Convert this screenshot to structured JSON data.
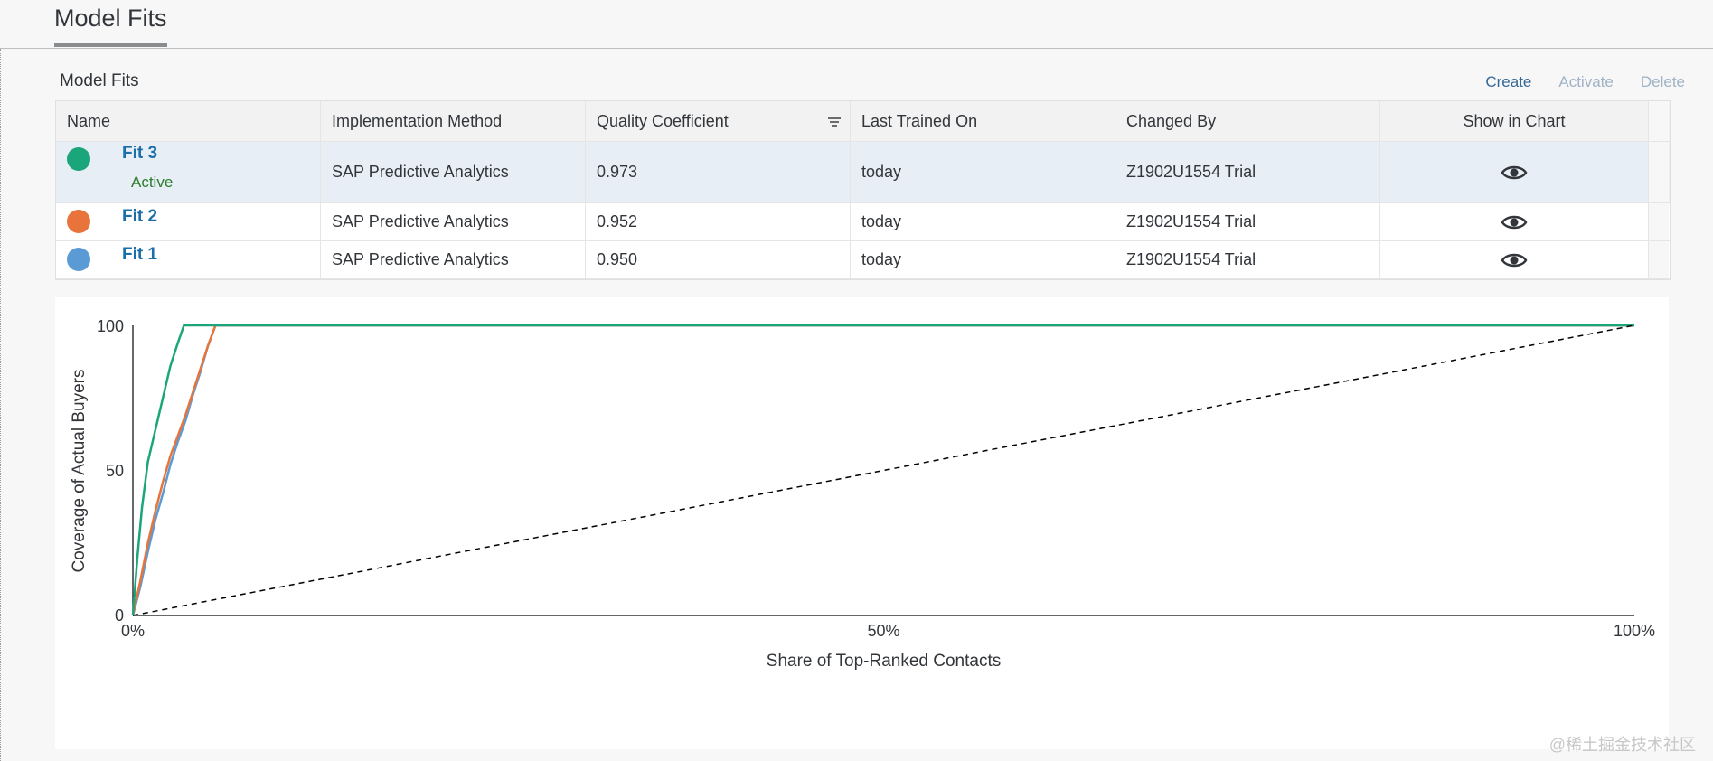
{
  "page": {
    "tab_title": "Model Fits"
  },
  "panel": {
    "title": "Model Fits",
    "actions": {
      "create": "Create",
      "activate": "Activate",
      "delete": "Delete"
    }
  },
  "table": {
    "headers": [
      "Name",
      "Implementation Method",
      "Quality Coefficient",
      "Last Trained On",
      "Changed By",
      "Show in Chart"
    ],
    "rows": [
      {
        "name": "Fit 3",
        "status": "Active",
        "method": "SAP Predictive Analytics",
        "quality": "0.973",
        "trained": "today",
        "changed_by": "Z1902U1554 Trial",
        "color": "#1aa67a"
      },
      {
        "name": "Fit 2",
        "status": "",
        "method": "SAP Predictive Analytics",
        "quality": "0.952",
        "trained": "today",
        "changed_by": "Z1902U1554 Trial",
        "color": "#e8743b"
      },
      {
        "name": "Fit 1",
        "status": "",
        "method": "SAP Predictive Analytics",
        "quality": "0.950",
        "trained": "today",
        "changed_by": "Z1902U1554 Trial",
        "color": "#5b9bd5"
      }
    ]
  },
  "chart_data": {
    "type": "line",
    "xlabel": "Share of Top-Ranked Contacts",
    "ylabel": "Coverage of Actual Buyers",
    "xlim": [
      0,
      100
    ],
    "ylim": [
      0,
      100
    ],
    "x_ticks": [
      "0%",
      "50%",
      "100%"
    ],
    "y_ticks": [
      "0",
      "50",
      "100"
    ],
    "grid": false,
    "series": [
      {
        "color": "#5b9bd5",
        "x": [
          0,
          0.5,
          1,
          1.5,
          2,
          2.5,
          3,
          3.5,
          4,
          4.5,
          5,
          5.5,
          100
        ],
        "y": [
          0,
          10,
          22,
          33,
          42,
          52,
          60,
          67,
          76,
          84,
          93,
          100,
          100
        ]
      },
      {
        "color": "#e8743b",
        "x": [
          0,
          0.5,
          1,
          1.5,
          2,
          2.5,
          3,
          3.5,
          4,
          4.5,
          5,
          5.5,
          100
        ],
        "y": [
          0,
          12,
          25,
          36,
          46,
          55,
          62,
          69,
          77,
          85,
          93,
          100,
          100
        ]
      },
      {
        "color": "#1aa67a",
        "x": [
          0,
          0.3,
          0.6,
          1,
          1.5,
          2,
          2.5,
          3,
          3.4,
          100
        ],
        "y": [
          0,
          20,
          37,
          53,
          64,
          75,
          86,
          94,
          100,
          100
        ]
      },
      {
        "color": "#000000",
        "dashed": true,
        "x": [
          0,
          100
        ],
        "y": [
          0,
          100
        ]
      }
    ]
  },
  "watermark": "@稀土掘金技术社区"
}
